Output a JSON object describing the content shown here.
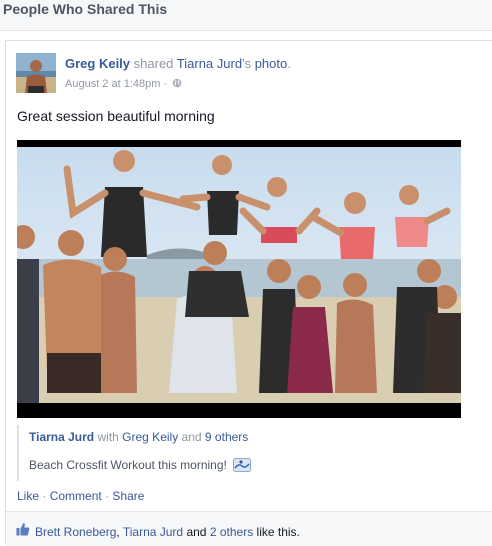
{
  "dialog": {
    "title": "People Who Shared This"
  },
  "story": {
    "actor": "Greg Keily",
    "verb": "shared",
    "owner": "Tiarna Jurd",
    "owner_suffix": "'s",
    "object": "photo",
    "end": ".",
    "timestamp": "August 2 at 1:48pm",
    "meta_separator": "·",
    "privacy_icon": "globe-icon",
    "message": "Great session beautiful morning",
    "photo_icon": "group-beach-photo"
  },
  "attachment": {
    "author": "Tiarna Jurd",
    "with_text": "with",
    "tagged": "Greg Keily",
    "and_text": "and",
    "others_link": "9 others",
    "caption": "Beach Crossfit Workout this morning!",
    "caption_icon": "surfer-emoji-icon"
  },
  "actions": {
    "like": "Like",
    "comment": "Comment",
    "share": "Share",
    "separator": "·"
  },
  "likes": {
    "icon": "thumbs-up-icon",
    "person1": "Brett Roneberg",
    "comma": ",",
    "person2": "Tiarna Jurd",
    "and_text": "and",
    "others_link": "2 others",
    "suffix": "like this."
  },
  "colors": {
    "link": "#3b5998",
    "muted": "#9197a3",
    "text": "#141823",
    "header_bg": "#f6f7f9"
  }
}
